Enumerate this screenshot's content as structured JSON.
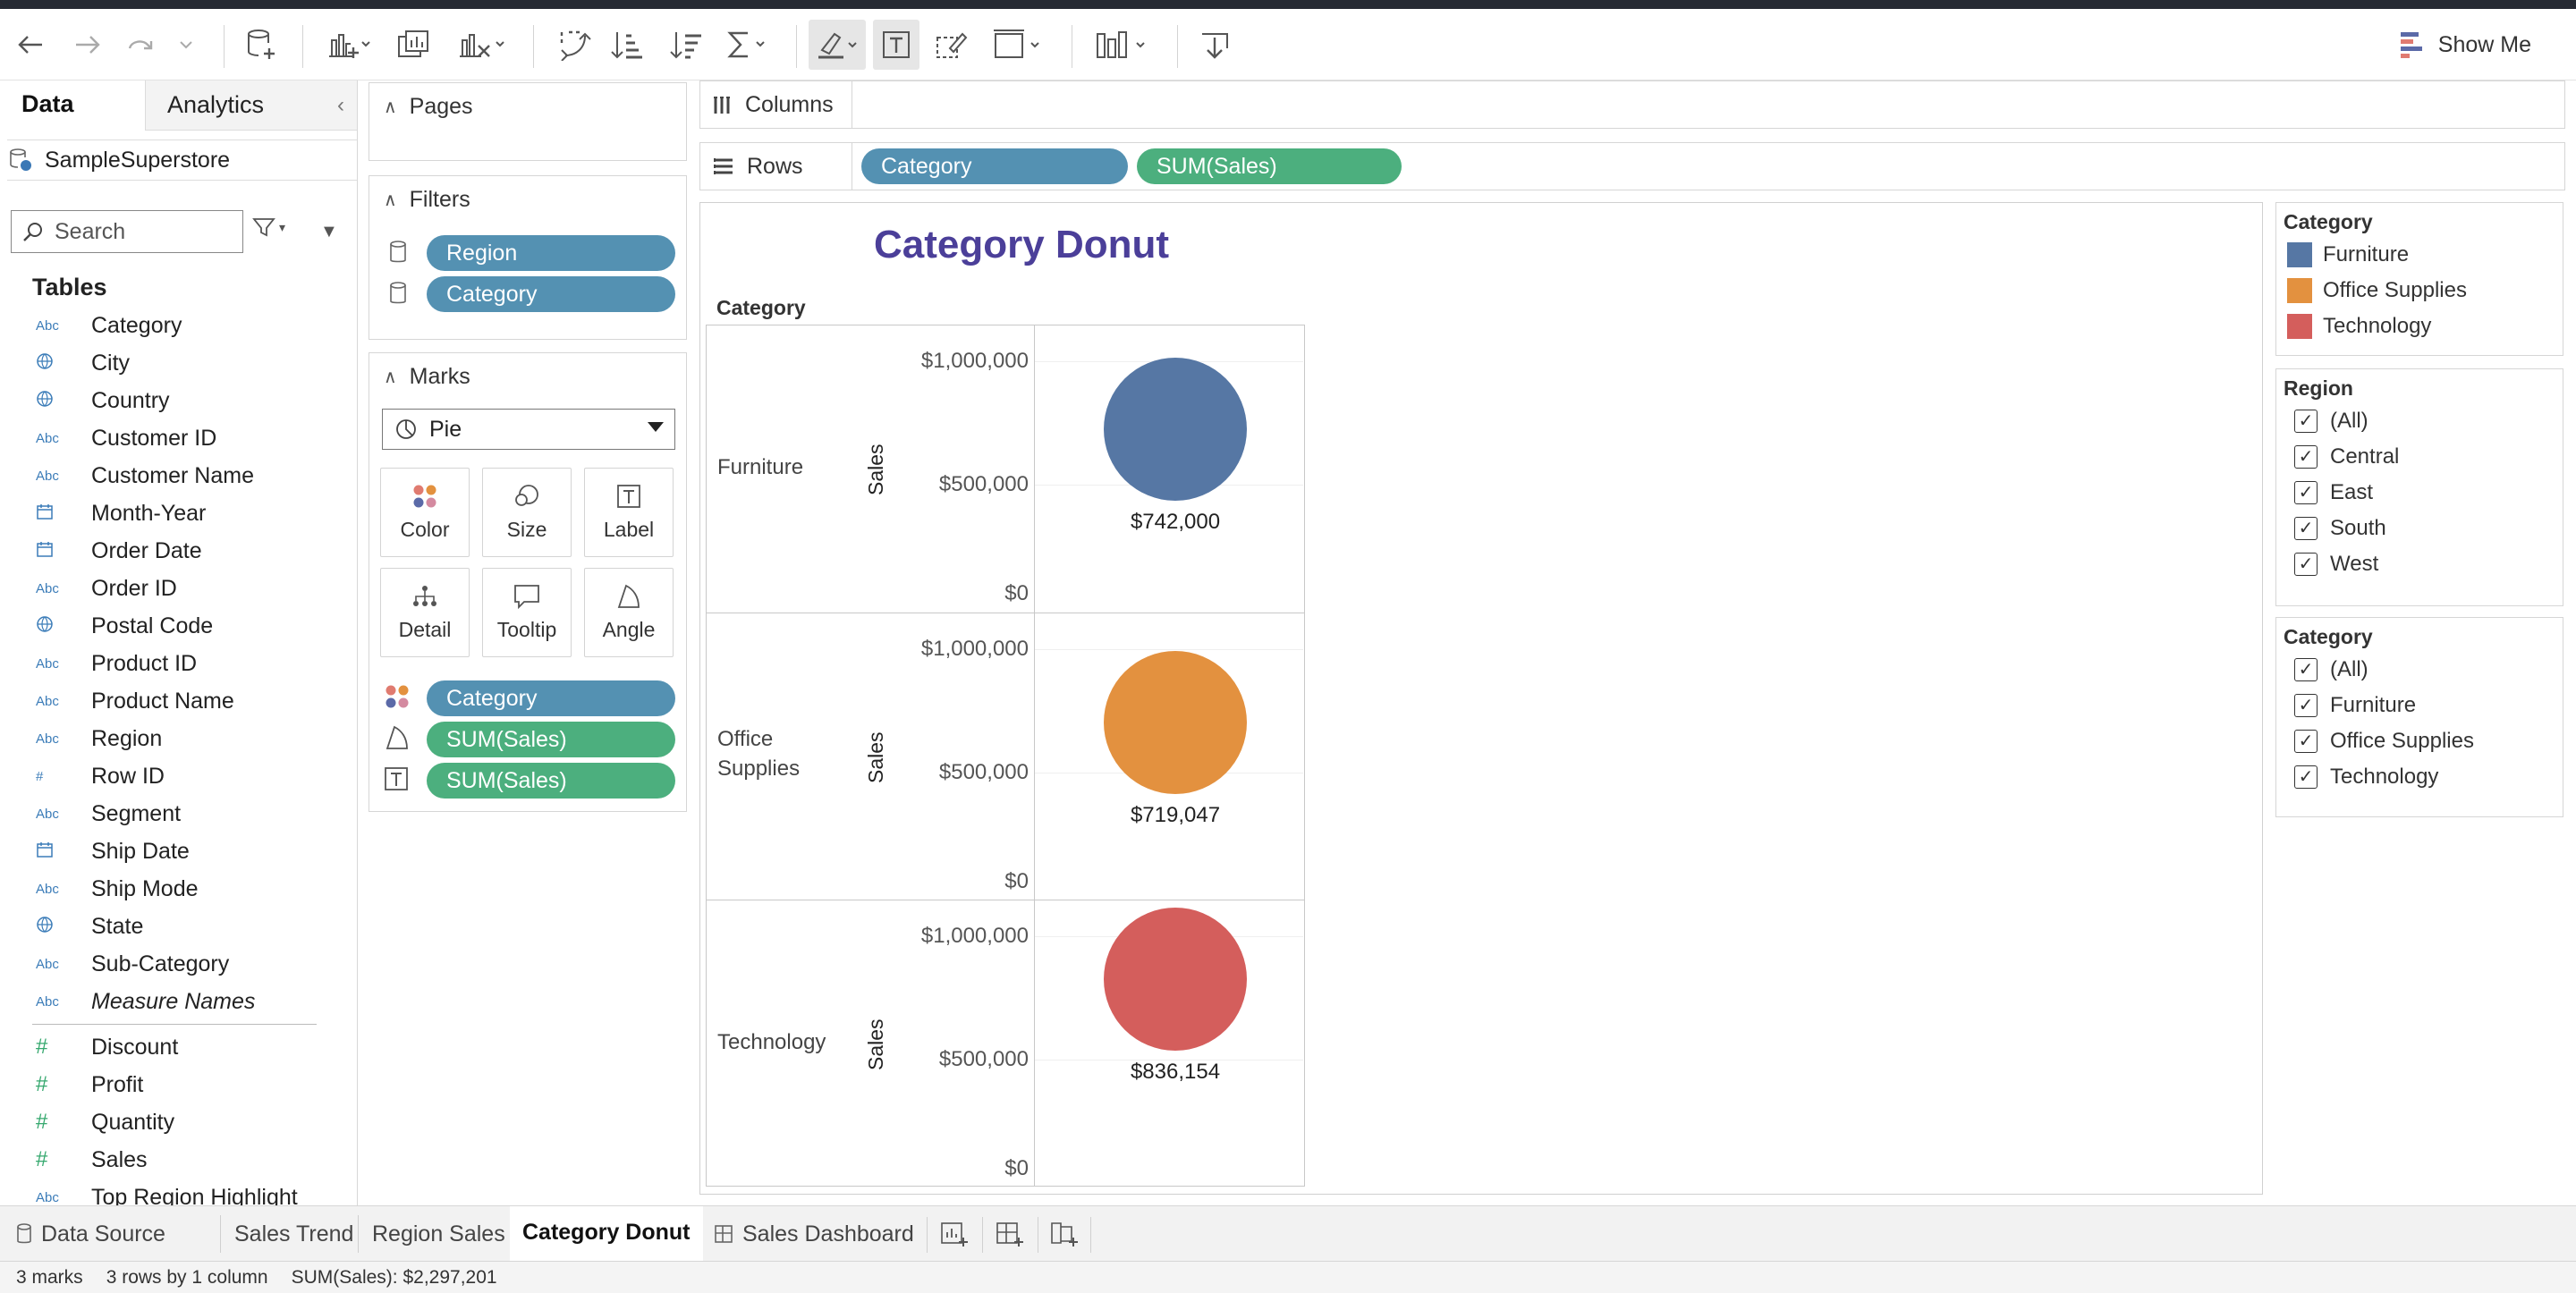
{
  "toolbar": {
    "show_me_label": "Show Me"
  },
  "datapane": {
    "tab_data": "Data",
    "tab_analytics": "Analytics",
    "datasource": "SampleSuperstore",
    "search_placeholder": "Search",
    "tables_title": "Tables",
    "fields": [
      {
        "label": "Category",
        "type": "Abc"
      },
      {
        "label": "City",
        "type": "geo"
      },
      {
        "label": "Country",
        "type": "geo"
      },
      {
        "label": "Customer ID",
        "type": "Abc"
      },
      {
        "label": "Customer Name",
        "type": "Abc"
      },
      {
        "label": "Month-Year",
        "type": "datetime"
      },
      {
        "label": "Order Date",
        "type": "date"
      },
      {
        "label": "Order ID",
        "type": "Abc"
      },
      {
        "label": "Postal Code",
        "type": "geo"
      },
      {
        "label": "Product ID",
        "type": "Abc"
      },
      {
        "label": "Product Name",
        "type": "Abc"
      },
      {
        "label": "Region",
        "type": "Abc"
      },
      {
        "label": "Row ID",
        "type": "#"
      },
      {
        "label": "Segment",
        "type": "Abc"
      },
      {
        "label": "Ship Date",
        "type": "date"
      },
      {
        "label": "Ship Mode",
        "type": "Abc"
      },
      {
        "label": "State",
        "type": "geo"
      },
      {
        "label": "Sub-Category",
        "type": "Abc"
      },
      {
        "label": "Measure Names",
        "type": "Abc"
      }
    ],
    "measures": [
      {
        "label": "Discount",
        "type": "#"
      },
      {
        "label": "Profit",
        "type": "#"
      },
      {
        "label": "Quantity",
        "type": "#"
      },
      {
        "label": "Sales",
        "type": "#"
      },
      {
        "label": "Top Region Highlight",
        "type": "Abc"
      }
    ]
  },
  "shelves": {
    "pages_title": "Pages",
    "filters_title": "Filters",
    "filters": [
      "Region",
      "Category"
    ],
    "marks_title": "Marks",
    "mark_type": "Pie",
    "mark_buttons": [
      "Color",
      "Size",
      "Label",
      "Detail",
      "Tooltip",
      "Angle"
    ],
    "mark_pills": [
      "Category",
      "SUM(Sales)",
      "SUM(Sales)"
    ],
    "columns_label": "Columns",
    "rows_label": "Rows",
    "rows_pills": [
      "Category",
      "SUM(Sales)"
    ]
  },
  "viz": {
    "title": "Category Donut",
    "row_header": "Category",
    "axis_title": "Sales",
    "ticks": [
      "$1,000,000",
      "$500,000",
      "$0"
    ]
  },
  "chart_data": {
    "type": "pie",
    "title": "Category Donut",
    "categories": [
      "Furniture",
      "Office Supplies",
      "Technology"
    ],
    "values": [
      742000,
      719047,
      836154
    ],
    "labels": [
      "$742,000",
      "$719,047",
      "$836,154"
    ],
    "colors": [
      "#5677a4",
      "#e3913f",
      "#d45e5c"
    ],
    "ylabel": "Sales",
    "ylim": [
      0,
      1000000
    ]
  },
  "legend": {
    "title": "Category",
    "items": [
      {
        "label": "Furniture",
        "color": "#5677a4"
      },
      {
        "label": "Office Supplies",
        "color": "#e3913f"
      },
      {
        "label": "Technology",
        "color": "#d45e5c"
      }
    ]
  },
  "region_filter": {
    "title": "Region",
    "items": [
      "(All)",
      "Central",
      "East",
      "South",
      "West"
    ]
  },
  "category_filter": {
    "title": "Category",
    "items": [
      "(All)",
      "Furniture",
      "Office Supplies",
      "Technology"
    ]
  },
  "sheet_tabs": {
    "data_source": "Data Source",
    "tabs": [
      "Sales Trend",
      "Region Sales",
      "Category Donut",
      "Sales Dashboard"
    ],
    "active": "Category Donut"
  },
  "status": {
    "marks": "3 marks",
    "dims": "3 rows by 1 column",
    "sum": "SUM(Sales): $2,297,201"
  }
}
